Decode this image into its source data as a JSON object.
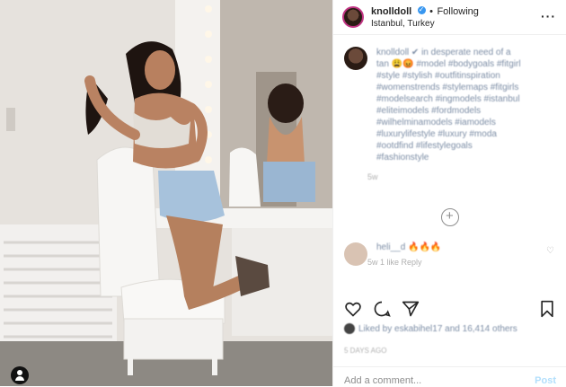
{
  "post": {
    "username": "knolldoll",
    "separator": "•",
    "follow_state": "Following",
    "location": "Istanbul, Turkey",
    "more_icon": "more-horizontal-icon"
  },
  "caption": {
    "username": "knolldoll",
    "lines": [
      "knolldoll ✔ in desperate need of a",
      "tan 😩😡 #model #bodygoals #fitgirl",
      "#style #stylish #outfitinspiration",
      "#womenstrends #stylemaps #fitgirls",
      "#modelsearch #ingmodels #istanbul",
      "#eliteimodels #fordmodels",
      "#wilhelminamodels #iamodels",
      "#luxurylifestyle #luxury #moda",
      "#ootdfind #lifestylegoals",
      "#fashionstyle"
    ],
    "time": "5w"
  },
  "comment": {
    "text": "heli__d 🔥🔥🔥",
    "meta": "5w  1 like  Reply"
  },
  "likes_text": "Liked by eskabihel17 and 16,414 others",
  "posted": "5 DAYS AGO",
  "add_comment": {
    "placeholder": "Add a comment...",
    "post_label": "Post"
  },
  "colors": {
    "accent_link": "#3897f0",
    "post_disabled": "#b2dffc",
    "story_ring": "#c13584"
  }
}
